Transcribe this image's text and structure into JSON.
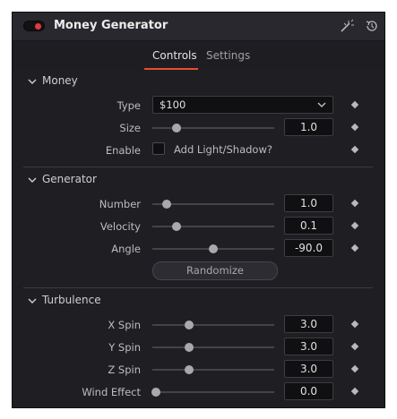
{
  "window": {
    "title": "Money Generator",
    "enabled": true,
    "accent": "#e3502f",
    "icons": [
      "magic-wand-icon",
      "reset-icon"
    ]
  },
  "tabs": [
    {
      "label": "Controls",
      "active": true
    },
    {
      "label": "Settings",
      "active": false
    }
  ],
  "sections": {
    "money": {
      "title": "Money",
      "type": {
        "label": "Type",
        "value": "$100"
      },
      "size": {
        "label": "Size",
        "value": "1.0",
        "fraction": 0.2
      },
      "enable": {
        "label": "Enable",
        "checkbox_label": "Add Light/Shadow?",
        "checked": false
      }
    },
    "generator": {
      "title": "Generator",
      "number": {
        "label": "Number",
        "value": "1.0",
        "fraction": 0.12
      },
      "velocity": {
        "label": "Velocity",
        "value": "0.1",
        "fraction": 0.2
      },
      "angle": {
        "label": "Angle",
        "value": "-90.0",
        "fraction": 0.5
      },
      "randomize": "Randomize"
    },
    "turbulence": {
      "title": "Turbulence",
      "x_spin": {
        "label": "X Spin",
        "value": "3.0",
        "fraction": 0.3
      },
      "y_spin": {
        "label": "Y Spin",
        "value": "3.0",
        "fraction": 0.3
      },
      "z_spin": {
        "label": "Z Spin",
        "value": "3.0",
        "fraction": 0.3
      },
      "wind_effect": {
        "label": "Wind Effect",
        "value": "0.0",
        "fraction": 0.03
      }
    }
  }
}
